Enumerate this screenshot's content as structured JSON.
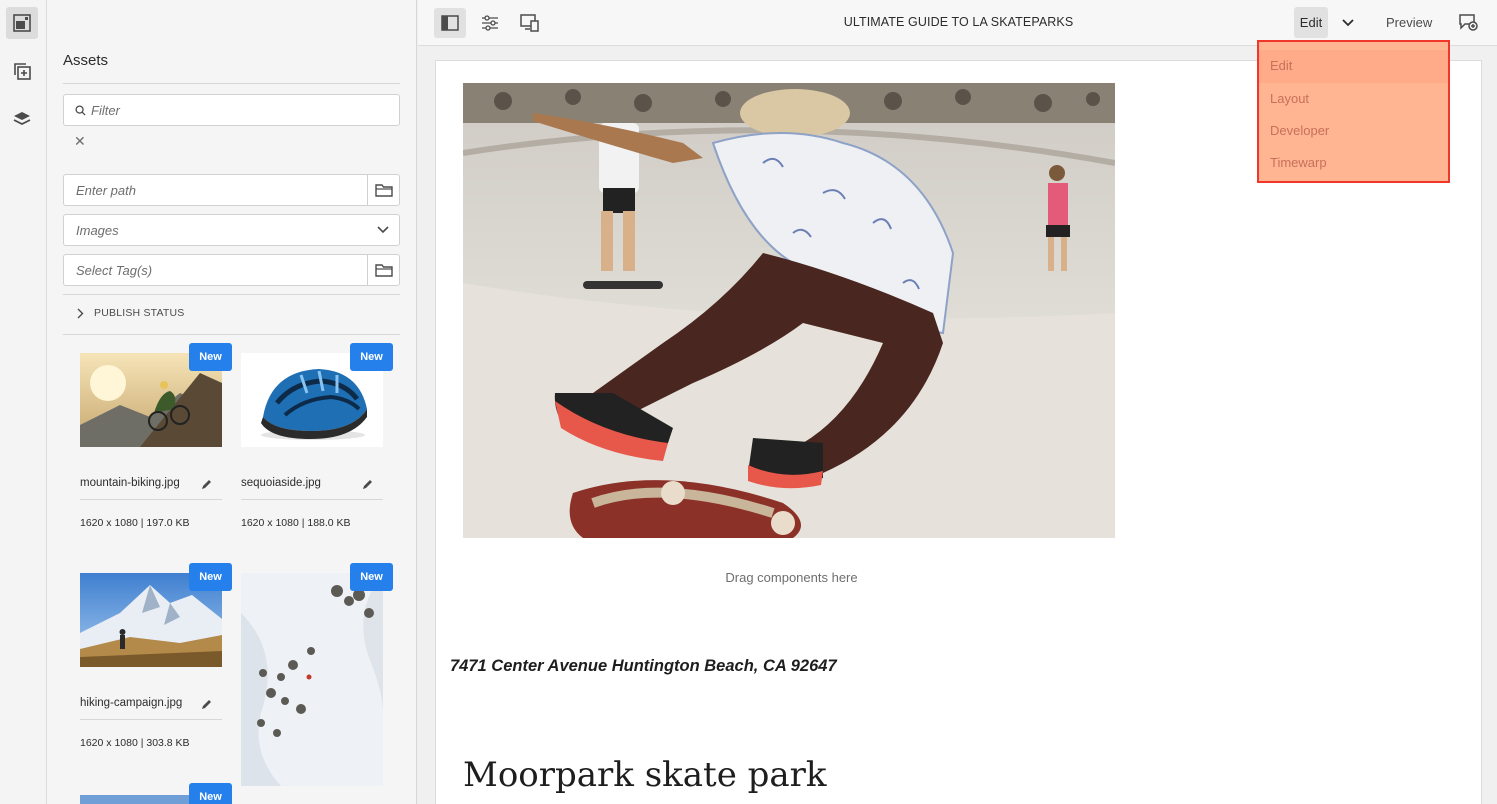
{
  "rail": {
    "items": [
      {
        "name": "assets-panel-icon",
        "active": true
      },
      {
        "name": "components-icon",
        "active": false
      },
      {
        "name": "content-tree-icon",
        "active": false
      }
    ]
  },
  "assets": {
    "title": "Assets",
    "filter_placeholder": "Filter",
    "clear_symbol": "✕",
    "path_placeholder": "Enter path",
    "type_value": "Images",
    "tags_placeholder": "Select Tag(s)",
    "publish_status_label": "PUBLISH STATUS",
    "badge_label": "New",
    "items": [
      {
        "file": "mountain-biking.jpg",
        "meta": "1620 x 1080 | 197.0 KB"
      },
      {
        "file": "sequoiaside.jpg",
        "meta": "1620 x 1080 | 188.0 KB"
      },
      {
        "file": "hiking-campaign.jpg",
        "meta": "1620 x 1080 | 303.8 KB"
      },
      {
        "file": "",
        "meta": ""
      }
    ]
  },
  "toolbar": {
    "page_title": "ULTIMATE GUIDE TO LA SKATEPARKS",
    "mode_label": "Edit",
    "preview_label": "Preview"
  },
  "mode_menu": {
    "items": [
      "Edit",
      "Layout",
      "Developer",
      "Timewarp"
    ],
    "selected": "Edit",
    "highlight_color": "#f0372a"
  },
  "page": {
    "drag_hint": "Drag components here",
    "address": "7471 Center Avenue Huntington Beach, CA 92647",
    "heading": "Moorpark skate park"
  },
  "colors": {
    "accent": "#2680eb",
    "menu_fill": "#ffb591"
  }
}
